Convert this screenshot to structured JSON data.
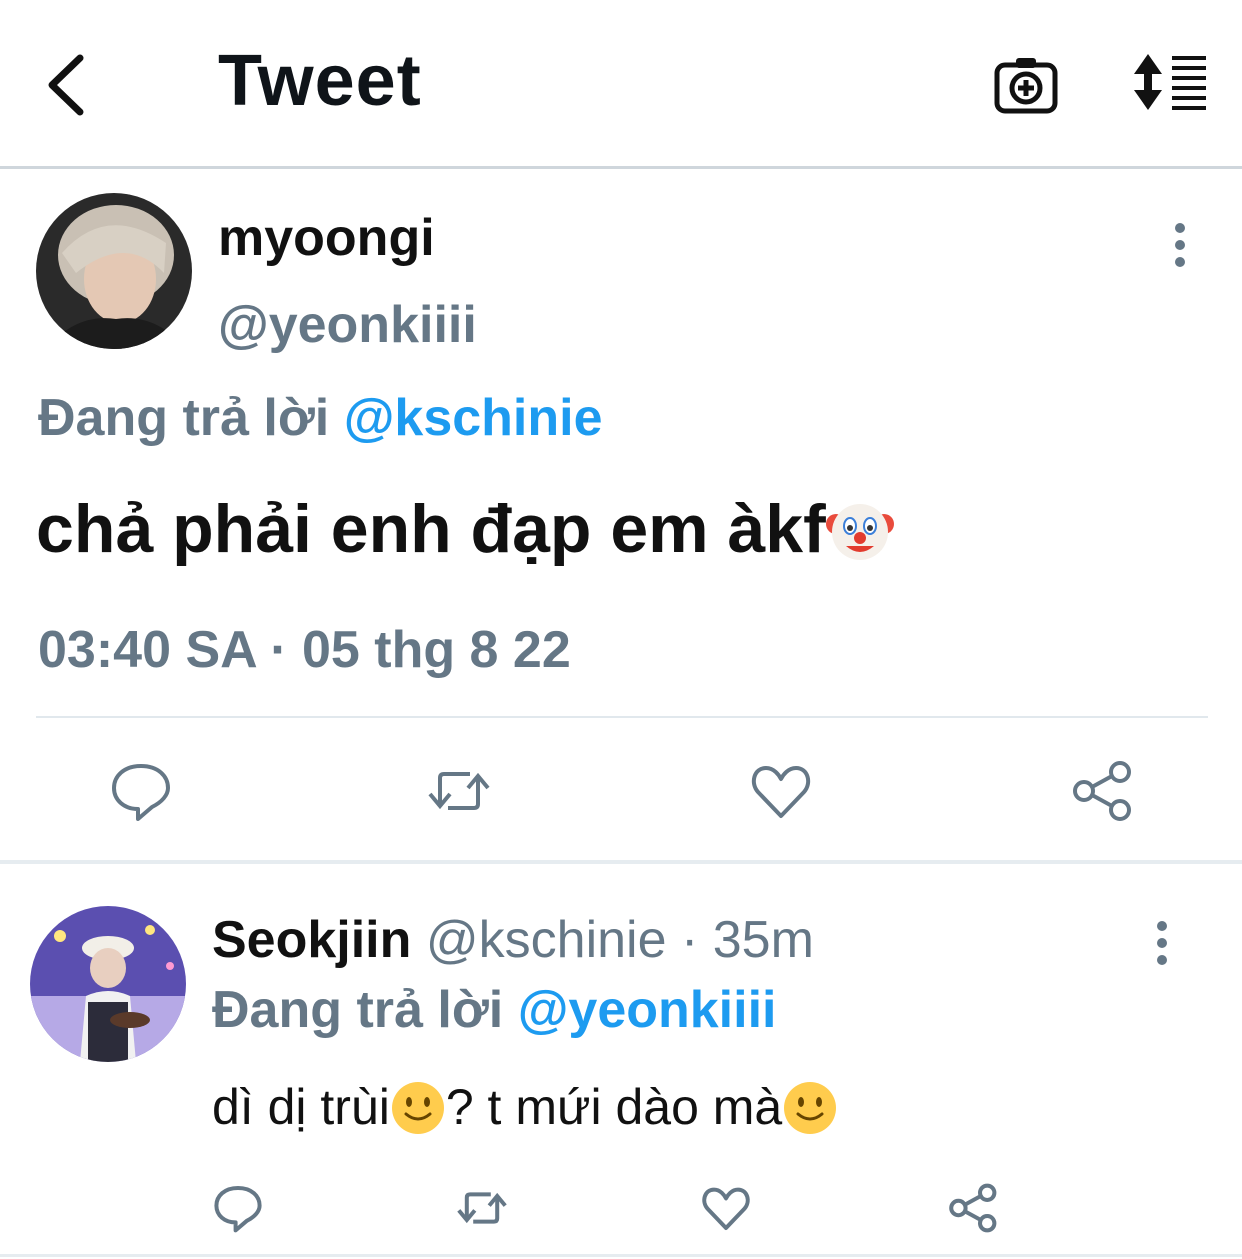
{
  "header": {
    "title": "Tweet",
    "back_icon": "back-chevron-icon",
    "camera_icon": "camera-plus-icon",
    "sort_icon": "sort-icon"
  },
  "tweet": {
    "name": "myoongi",
    "handle": "@yeonkiiii",
    "replying_prefix": "Đang trả lời",
    "replying_to": "@kschinie",
    "text": "chả phải enh đạp em àkf",
    "emoji": "clown-face-emoji",
    "timestamp": "03:40 SA · 05 thg 8 22"
  },
  "reply": {
    "name": "Seokjiin",
    "handle": "@kschinie",
    "dot": "·",
    "time": "35m",
    "replying_prefix": "Đang trả lời",
    "replying_to": "@yeonkiiii",
    "text_part1": "dì dị trùi",
    "text_part2": "? t mứi dào mà",
    "emoji": "slightly-smiling-face-emoji"
  },
  "colors": {
    "accent": "#1d9bf0",
    "secondary": "#657786",
    "text": "#111111"
  }
}
